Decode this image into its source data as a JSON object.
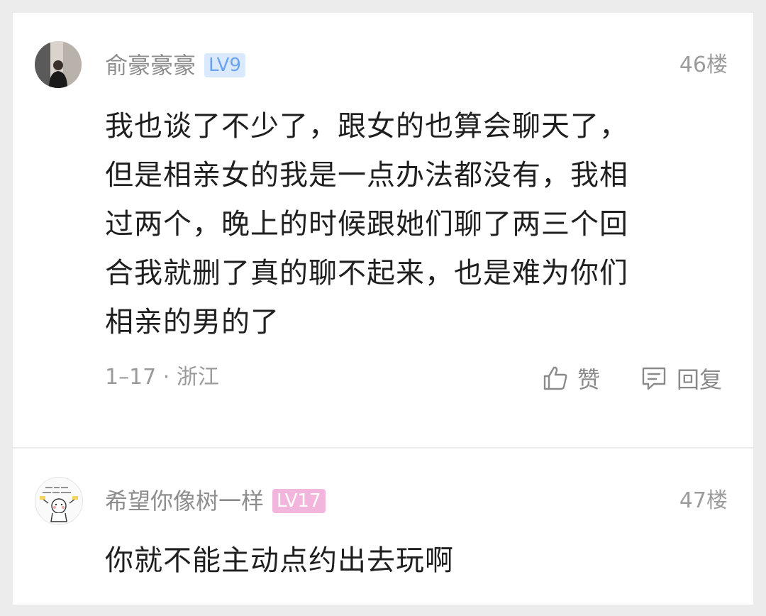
{
  "comments": [
    {
      "username": "俞豪豪豪",
      "level": "LV9",
      "floor": "46楼",
      "content_lines": [
        "我也谈了不少了，跟女的也算会聊天了，",
        "但是相亲女的我是一点办法都没有，我相",
        "过两个，晚上的时候跟她们聊了两三个回",
        "合我就删了真的聊不起来，也是难为你们",
        "相亲的男的了"
      ],
      "meta": "1–17 · 浙江",
      "like_label": "赞",
      "reply_label": "回复",
      "avatar_icon": "person-photo-avatar",
      "like_icon": "thumbs-up-icon",
      "reply_icon": "comment-bubble-icon"
    },
    {
      "username": "希望你像树一样",
      "level": "LV17",
      "floor": "47楼",
      "content_lines": [
        "你就不能主动点约出去玩啊"
      ],
      "avatar_icon": "cartoon-doodle-avatar"
    }
  ],
  "colors": {
    "background": "#ececec",
    "card": "#ffffff",
    "level_blue": "#6aa3f0",
    "level_blue_bg": "#dbe9fd",
    "level_pink_bg": "#f2b5dc"
  }
}
